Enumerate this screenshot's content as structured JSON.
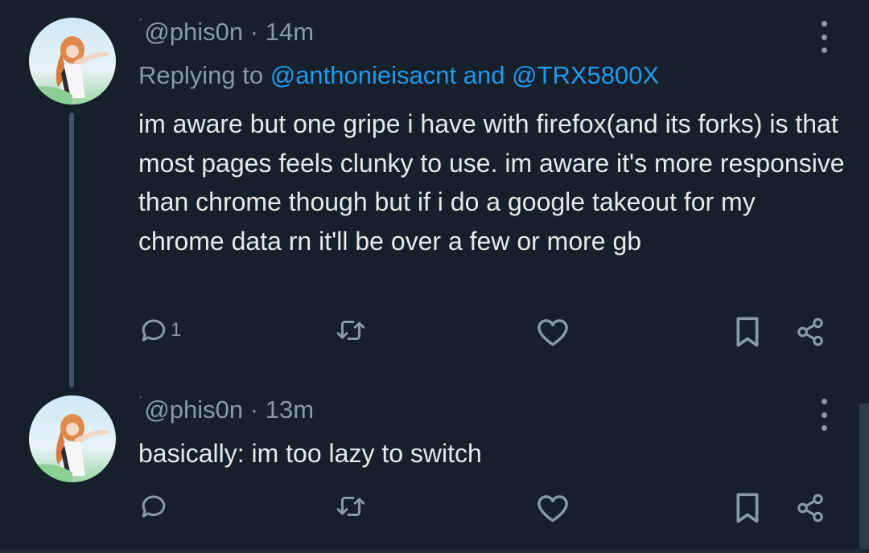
{
  "tweets": [
    {
      "handle": "@phis0n",
      "time": "· 14m",
      "replying_prefix": "Replying to ",
      "mention1": "@anthonieisacnt",
      "and": " and ",
      "mention2": "@TRX5800X",
      "text": "im aware but one gripe i have with firefox(and its forks) is that most pages feels clunky to use. im aware it's more responsive than chrome though but if i do a google takeout for my chrome data rn it'll be over a few or more gb",
      "reply_count": "1"
    },
    {
      "handle": "@phis0n",
      "time": "· 13m",
      "text": "basically: im too lazy to switch",
      "reply_count": ""
    }
  ],
  "badge": "ˊ",
  "icons": {
    "reply": "reply-icon",
    "retweet": "retweet-icon",
    "like": "like-icon",
    "bookmark": "bookmark-icon",
    "share": "share-icon",
    "more": "more-icon"
  },
  "colors": {
    "background": "#15202b",
    "text": "#e7e9ea",
    "muted": "#8b98a5",
    "accent": "#1d9bf0",
    "thread_line": "#42536a"
  }
}
